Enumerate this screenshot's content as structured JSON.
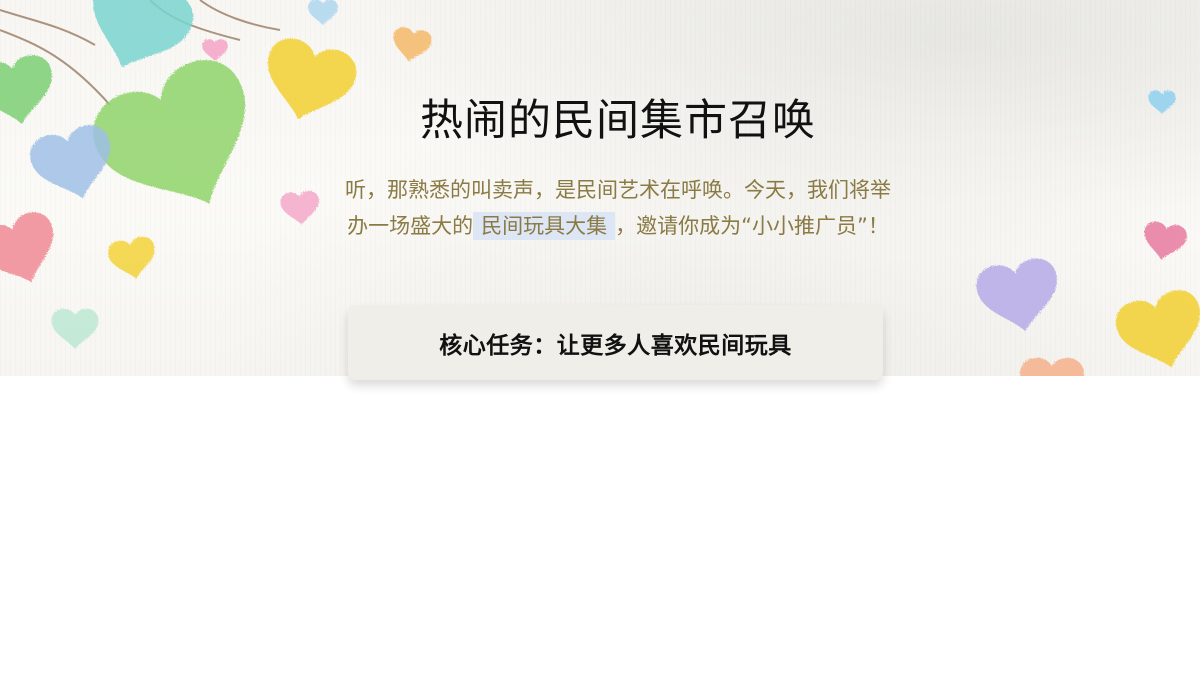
{
  "slide": {
    "title": "热闹的民间集市召唤",
    "intro": {
      "part1": "听，那熟悉的叫卖声，是民间艺术在呼唤。今天，我们将举办一场盛大的",
      "highlight": "民间玩具大集",
      "part2": "，邀请你成为“小小推广员”！"
    },
    "task_card": {
      "text": "核心任务：让更多人喜欢民间玩具"
    }
  },
  "decorations": {
    "icon": "watercolor-heart-icon",
    "colors": [
      "#8fd46a",
      "#f2d23a",
      "#7ad3cf",
      "#f08a94",
      "#b5a9e6",
      "#9fbfe6",
      "#f3a7c8",
      "#f5b08a"
    ]
  }
}
